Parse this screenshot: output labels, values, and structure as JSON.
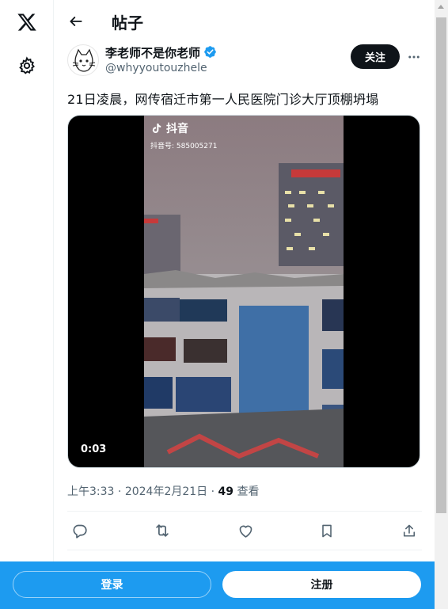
{
  "header": {
    "title": "帖子"
  },
  "post": {
    "author_name": "李老师不是你老师",
    "author_handle": "@whyyoutouzhele",
    "follow_label": "关注",
    "text": "21日凌晨，网传宿迁市第一人民医院门诊大厅顶棚坍塌",
    "video": {
      "watermark_brand": "抖音",
      "watermark_id": "抖音号: 585005271",
      "duration": "0:03"
    },
    "time": "上午3:33",
    "date": "2024年2月21日",
    "separator": " · ",
    "views_count": "49",
    "views_label": "查看"
  },
  "footer": {
    "login_label": "登录",
    "signup_label": "注册"
  },
  "icons": {
    "logo": "x-logo-icon",
    "settings": "gear-icon",
    "back": "arrow-left-icon",
    "verified": "verified-badge-icon",
    "more": "more-horizontal-icon",
    "reply": "reply-icon",
    "repost": "repost-icon",
    "like": "heart-icon",
    "bookmark": "bookmark-icon",
    "share": "share-icon"
  },
  "colors": {
    "accent": "#1d9bf0",
    "text": "#0f1419",
    "secondary": "#536471"
  }
}
